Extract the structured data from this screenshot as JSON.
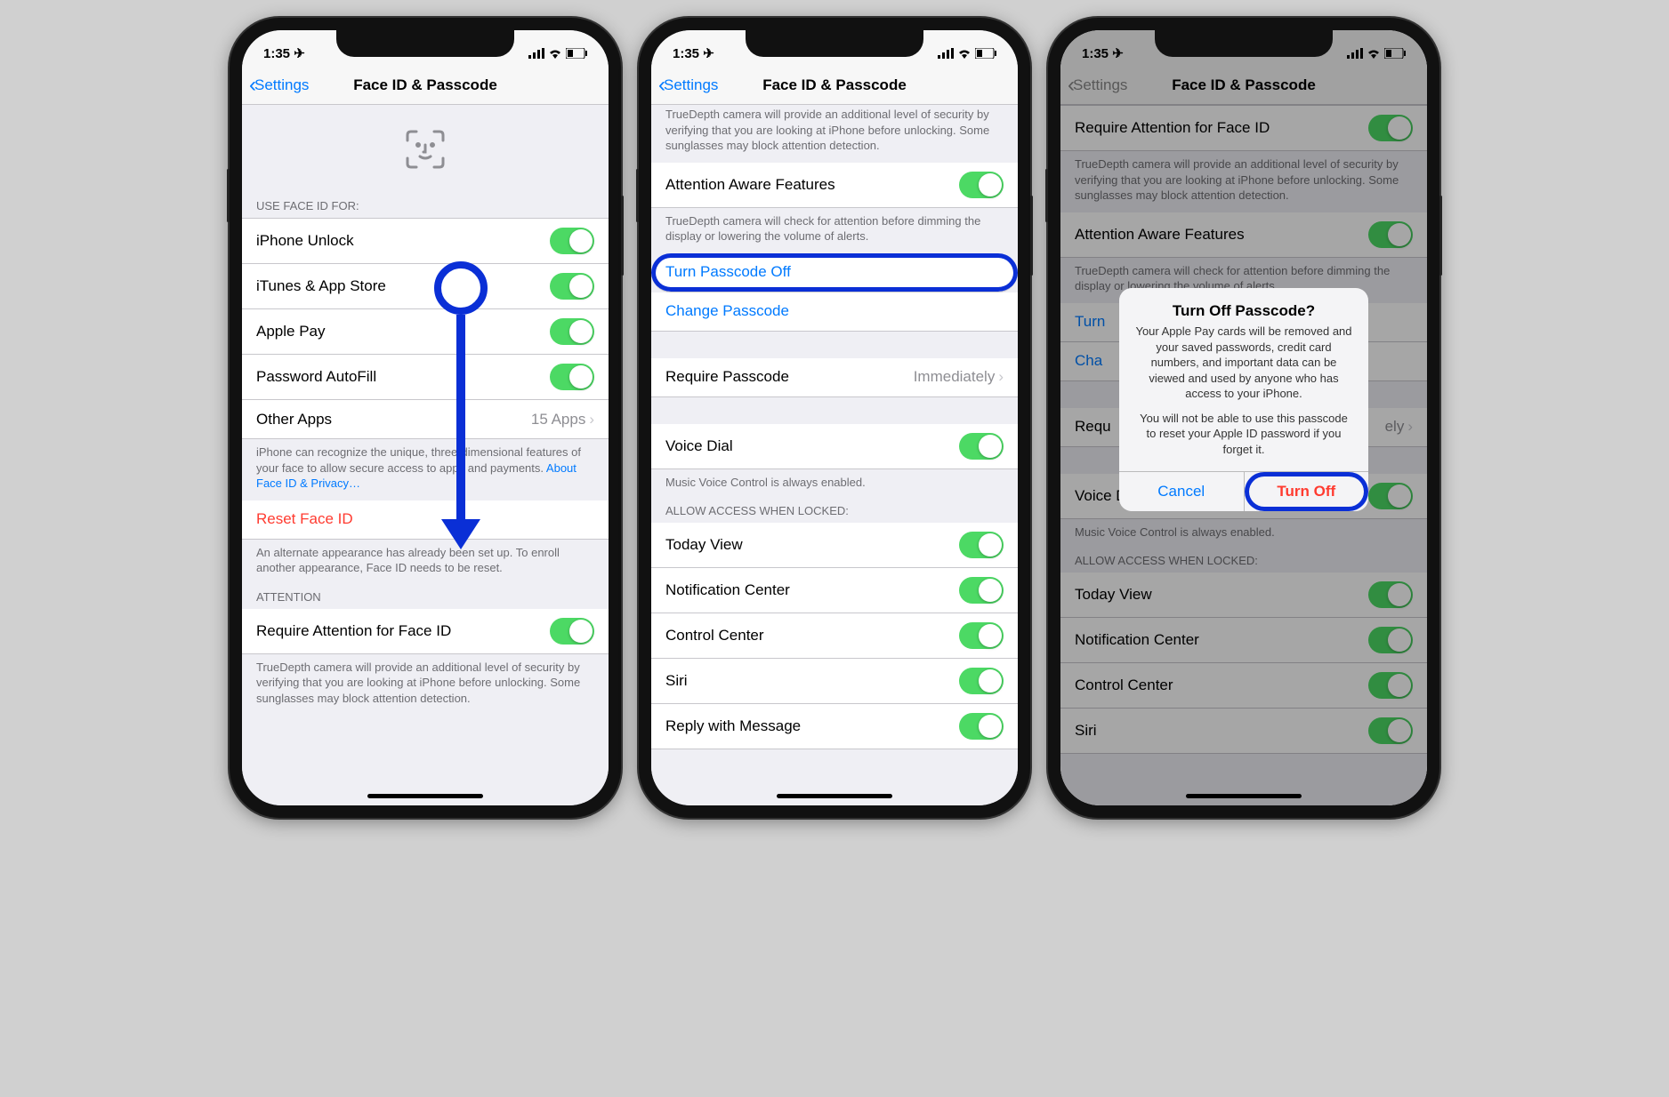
{
  "status": {
    "time": "1:35",
    "loc_arrow": "➤"
  },
  "nav": {
    "back": "Settings",
    "title": "Face ID & Passcode"
  },
  "screen1": {
    "sec_use_header": "USE FACE ID FOR:",
    "rows_use": [
      {
        "label": "iPhone Unlock"
      },
      {
        "label": "iTunes & App Store"
      },
      {
        "label": "Apple Pay"
      },
      {
        "label": "Password AutoFill"
      }
    ],
    "other_apps": {
      "label": "Other Apps",
      "detail": "15 Apps"
    },
    "footer_use": "iPhone can recognize the unique, three-dimensional features of your face to allow secure access to apps and payments.",
    "footer_link": "About Face ID & Privacy…",
    "reset": "Reset Face ID",
    "footer_reset": "An alternate appearance has already been set up. To enroll another appearance, Face ID needs to be reset.",
    "sec_attn_header": "ATTENTION",
    "req_attn": "Require Attention for Face ID",
    "footer_attn": "TrueDepth camera will provide an additional level of security by verifying that you are looking at iPhone before unlocking. Some sunglasses may block attention detection."
  },
  "screen2": {
    "footer_top": "TrueDepth camera will provide an additional level of security by verifying that you are looking at iPhone before unlocking. Some sunglasses may block attention detection.",
    "attn_aware": "Attention Aware Features",
    "footer_attn_aware": "TrueDepth camera will check for attention before dimming the display or lowering the volume of alerts.",
    "turn_off": "Turn Passcode Off",
    "change": "Change Passcode",
    "require": {
      "label": "Require Passcode",
      "detail": "Immediately"
    },
    "voice_dial": "Voice Dial",
    "footer_voice": "Music Voice Control is always enabled.",
    "sec_allow_header": "ALLOW ACCESS WHEN LOCKED:",
    "allow_rows": [
      {
        "label": "Today View"
      },
      {
        "label": "Notification Center"
      },
      {
        "label": "Control Center"
      },
      {
        "label": "Siri"
      },
      {
        "label": "Reply with Message"
      }
    ]
  },
  "screen3": {
    "req_attn": "Require Attention for Face ID",
    "footer_top": "TrueDepth camera will provide an additional level of security by verifying that you are looking at iPhone before unlocking. Some sunglasses may block attention detection.",
    "attn_aware": "Attention Aware Features",
    "footer_attn_aware": "TrueDepth camera will check for attention before dimming the display or lowering the volume of alerts.",
    "turn_off_partial": "Turn",
    "change_partial": "Cha",
    "require_partial": {
      "label": "Requ",
      "detail": "ely"
    },
    "voice_dial": "Voice Dial",
    "footer_voice": "Music Voice Control is always enabled.",
    "sec_allow_header": "ALLOW ACCESS WHEN LOCKED:",
    "allow_rows": [
      {
        "label": "Today View"
      },
      {
        "label": "Notification Center"
      },
      {
        "label": "Control Center"
      },
      {
        "label": "Siri"
      }
    ],
    "alert": {
      "title": "Turn Off Passcode?",
      "msg1": "Your Apple Pay cards will be removed and your saved passwords, credit card numbers, and important data can be viewed and used by anyone who has access to your iPhone.",
      "msg2": "You will not be able to use this passcode to reset your Apple ID password if you forget it.",
      "cancel": "Cancel",
      "confirm": "Turn Off"
    }
  }
}
